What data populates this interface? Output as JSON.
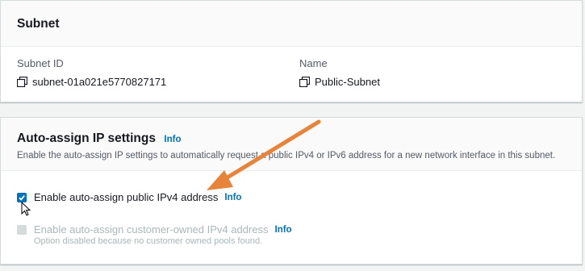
{
  "subnet_panel": {
    "title": "Subnet",
    "subnet_id_label": "Subnet ID",
    "subnet_id_value": "subnet-01a021e5770827171",
    "name_label": "Name",
    "name_value": "Public-Subnet"
  },
  "auto_assign_panel": {
    "title": "Auto-assign IP settings",
    "info_label": "Info",
    "description": "Enable the auto-assign IP settings to automatically request a public IPv4 or IPv6 address for a new network interface in this subnet.",
    "public_ipv4": {
      "label": "Enable auto-assign public IPv4 address",
      "info": "Info",
      "checked": true
    },
    "customer_owned_ipv4": {
      "label": "Enable auto-assign customer-owned IPv4 address",
      "info": "Info",
      "note": "Option disabled because no customer owned pools found.",
      "checked": false,
      "disabled": true
    }
  },
  "colors": {
    "accent": "#0073bb",
    "annotation_arrow": "#e8833a",
    "panel_bg": "#ffffff",
    "header_bg": "#fafafa"
  },
  "icons": [
    "copy-icon",
    "copy-icon",
    "checkbox-checked-icon",
    "checkbox-disabled-icon",
    "cursor-icon",
    "annotation-arrow"
  ]
}
